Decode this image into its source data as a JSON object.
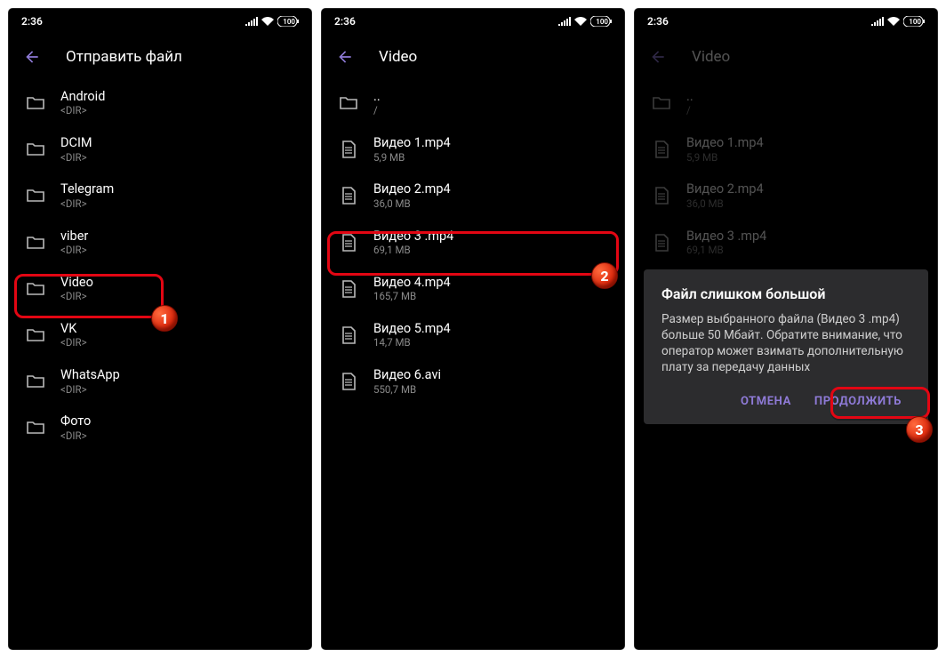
{
  "statusbar": {
    "time": "2:36",
    "battery": "100"
  },
  "badges": {
    "b1": "1",
    "b2": "2",
    "b3": "3"
  },
  "screen1": {
    "title": "Отправить файл",
    "rows": [
      {
        "name": "Android",
        "sub": "<DIR>"
      },
      {
        "name": "DCIM",
        "sub": "<DIR>"
      },
      {
        "name": "Telegram",
        "sub": "<DIR>"
      },
      {
        "name": "viber",
        "sub": "<DIR>"
      },
      {
        "name": "Video",
        "sub": "<DIR>"
      },
      {
        "name": "VK",
        "sub": "<DIR>"
      },
      {
        "name": "WhatsApp",
        "sub": "<DIR>"
      },
      {
        "name": "Фото",
        "sub": "<DIR>"
      }
    ]
  },
  "screen2": {
    "title": "Video",
    "up": {
      "name": "..",
      "sub": "/"
    },
    "rows": [
      {
        "name": "Видео 1.mp4",
        "sub": "5,9 MB"
      },
      {
        "name": "Видео 2.mp4",
        "sub": "36,0 MB"
      },
      {
        "name": "Видео 3 .mp4",
        "sub": "69,1 MB"
      },
      {
        "name": "Видео 4.mp4",
        "sub": "165,7 MB"
      },
      {
        "name": "Видео 5.mp4",
        "sub": "14,7 MB"
      },
      {
        "name": "Видео 6.avi",
        "sub": "550,7 MB"
      }
    ]
  },
  "screen3": {
    "title": "Video",
    "up": {
      "name": "..",
      "sub": "/"
    },
    "rows": [
      {
        "name": "Видео 1.mp4",
        "sub": "5,9 MB"
      },
      {
        "name": "Видео 2.mp4",
        "sub": "36,0 MB"
      },
      {
        "name": "Видео 3 .mp4",
        "sub": "69,1 MB"
      }
    ],
    "dialog": {
      "title": "Файл слишком большой",
      "body": "Размер выбранного файла (Видео 3 .mp4) больше 50 Мбайт. Обратите внимание, что оператор может взимать дополнительную плату за передачу данных",
      "cancel": "ОТМЕНА",
      "continue": "ПРОДОЛЖИТЬ"
    }
  }
}
